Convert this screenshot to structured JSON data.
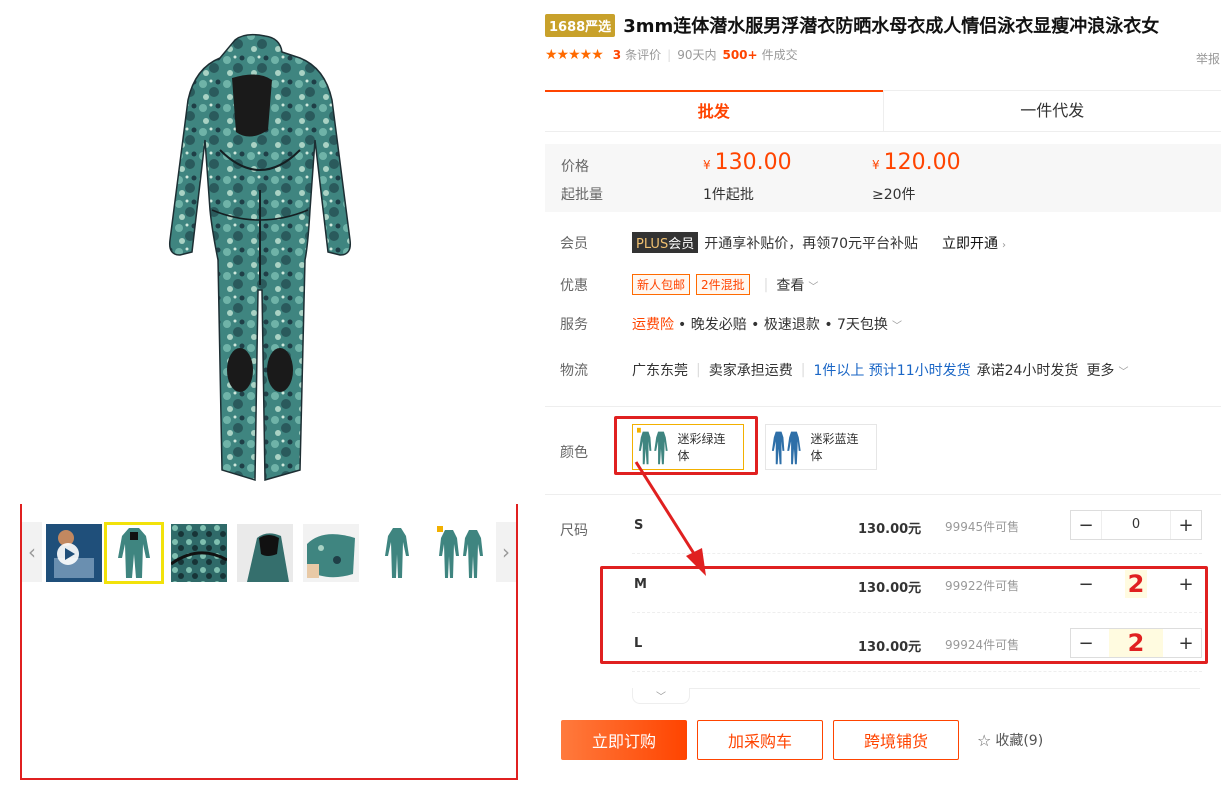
{
  "product": {
    "badge": "1688严选",
    "title": "3mm连体潜水服男浮潜衣防晒水母衣成人情侣泳衣显瘦冲浪泳衣女",
    "rating_stars": "★★★★★",
    "review_count": "3",
    "review_label": "条评价",
    "sales_period": "90天内",
    "sales_count": "500+",
    "sales_label": "件成交",
    "report": "举报"
  },
  "tabs": [
    {
      "label": "批发"
    },
    {
      "label": "一件代发"
    }
  ],
  "price": {
    "price_label": "价格",
    "moq_label": "起批量",
    "currency": "¥",
    "tier1_price": "130.00",
    "tier1_qty": "1件起批",
    "tier2_price": "120.00",
    "tier2_qty": "≥20件"
  },
  "member": {
    "label": "会员",
    "badge_plus": "PLUS",
    "badge_member": "会员",
    "text": "开通享补贴价，再领70元平台补贴",
    "link": "立即开通",
    "chevron": "›"
  },
  "promo": {
    "label": "优惠",
    "coupons": [
      "新人包邮",
      "2件混批"
    ],
    "view": "查看",
    "chevron": "﹀"
  },
  "service": {
    "label": "服务",
    "insurance": "运费险",
    "rest": "• 晚发必赔 • 极速退款 • 7天包换",
    "chevron": "﹀"
  },
  "logistics": {
    "label": "物流",
    "origin": "广东东莞",
    "shipping_fee": "卖家承担运费",
    "estimate": "1件以上  预计11小时发货",
    "promise": "承诺24小时发货",
    "more": "更多",
    "chevron": "﹀"
  },
  "color": {
    "label": "颜色",
    "options": [
      {
        "label": "迷彩绿连体",
        "selected": true
      },
      {
        "label": "迷彩蓝连体",
        "selected": false
      }
    ]
  },
  "sizes": {
    "label": "尺码",
    "rows": [
      {
        "name": "S",
        "price": "130.00元",
        "stock": "99945件可售",
        "qty": "0"
      },
      {
        "name": "M",
        "price": "130.00元",
        "stock": "99922件可售",
        "qty": "2"
      },
      {
        "name": "L",
        "price": "130.00元",
        "stock": "99924件可售",
        "qty": "2"
      }
    ],
    "minus": "−",
    "plus": "+",
    "collapse": "﹀"
  },
  "actions": {
    "buy_now": "立即订购",
    "add_cart": "加采购车",
    "cross_border": "跨境铺货",
    "favorite": "收藏(9)"
  },
  "gallery": {
    "prev": "‹",
    "next": "›"
  },
  "colors": {
    "accent": "#ff4400",
    "annotation": "#e02020",
    "suit_base": "#3d7f7c",
    "suit_blue": "#2e6fa8"
  }
}
